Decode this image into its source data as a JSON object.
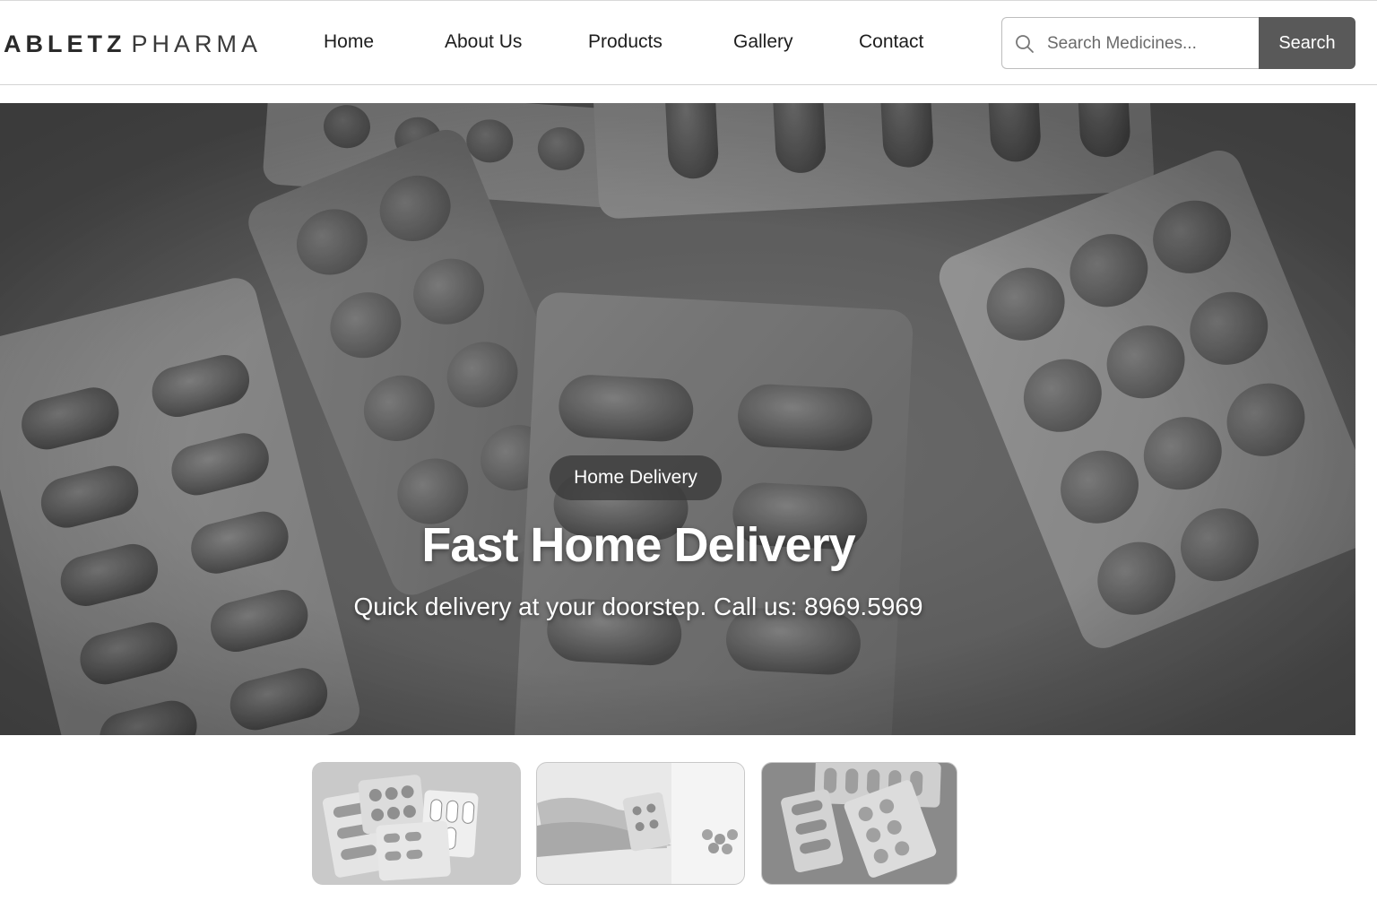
{
  "brand": {
    "part1": "ABLETZ",
    "part2": "PHARMA"
  },
  "nav": {
    "items": [
      {
        "label": "Home"
      },
      {
        "label": "About Us"
      },
      {
        "label": "Products"
      },
      {
        "label": "Gallery"
      },
      {
        "label": "Contact"
      }
    ]
  },
  "search": {
    "placeholder": "Search Medicines...",
    "value": "",
    "button_label": "Search"
  },
  "hero": {
    "badge": "Home Delivery",
    "title": "Fast Home Delivery",
    "subtitle": "Quick delivery at your doorstep. Call us: 8969.5969"
  },
  "gallery": {
    "thumbnails_count": 3
  },
  "colors": {
    "search_button": "#595959",
    "badge": "#3c3c3c",
    "hero_text": "#ffffff"
  }
}
